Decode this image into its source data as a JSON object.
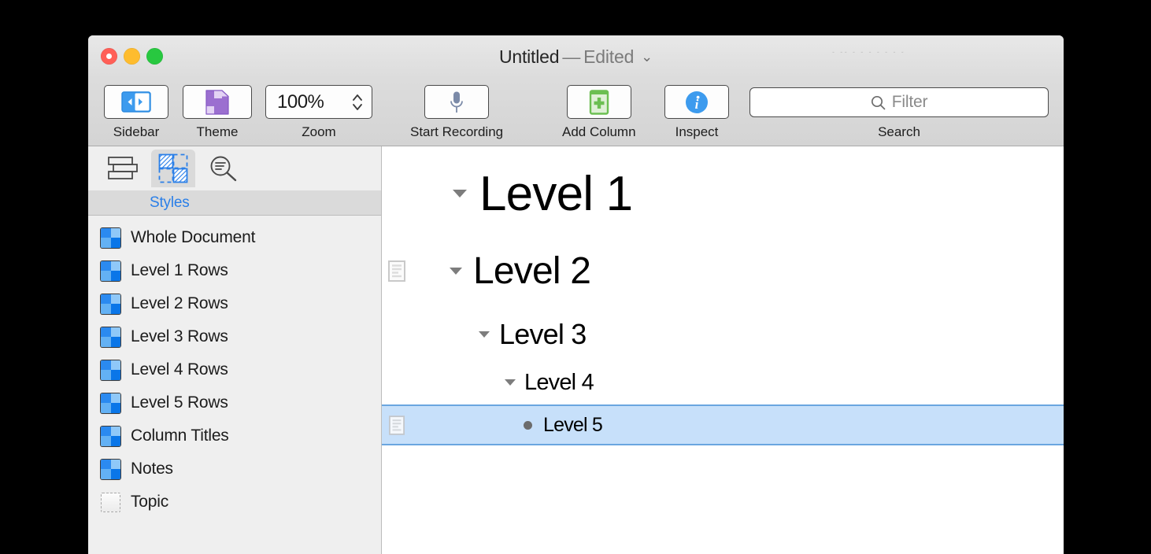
{
  "window": {
    "title_main": "Untitled",
    "title_dash": "—",
    "title_status": "Edited",
    "title_chevron": "⌄",
    "ghost_strip": "- -- - -  -  -   -  -  -"
  },
  "traffic_lights": {
    "close": "close-button",
    "minimize": "minimize-button",
    "maximize": "maximize-button"
  },
  "toolbar": {
    "sidebar": {
      "label": "Sidebar",
      "icon": "sidebar-icon"
    },
    "theme": {
      "label": "Theme",
      "icon": "theme-document-icon"
    },
    "zoom": {
      "label": "Zoom",
      "value": "100%",
      "icon": "stepper-icon"
    },
    "record": {
      "label": "Start Recording",
      "icon": "microphone-icon"
    },
    "add_column": {
      "label": "Add Column",
      "icon": "add-column-icon"
    },
    "inspect": {
      "label": "Inspect",
      "icon": "info-icon"
    },
    "search": {
      "label": "Search",
      "placeholder": "Filter",
      "value": "",
      "icon": "search-icon"
    }
  },
  "sidebar": {
    "tabs": [
      {
        "name": "outline",
        "icon": "outline-structure-icon",
        "selected": false
      },
      {
        "name": "styles",
        "icon": "styles-checkerboard-icon",
        "selected": true
      },
      {
        "name": "search",
        "icon": "filter-search-icon",
        "selected": false
      }
    ],
    "active_tab_title": "Styles",
    "styles": [
      {
        "label": "Whole Document",
        "swatch": "checkerboard"
      },
      {
        "label": "Level 1 Rows",
        "swatch": "checkerboard"
      },
      {
        "label": "Level 2 Rows",
        "swatch": "checkerboard"
      },
      {
        "label": "Level 3 Rows",
        "swatch": "checkerboard"
      },
      {
        "label": "Level 4 Rows",
        "swatch": "checkerboard"
      },
      {
        "label": "Level 5 Rows",
        "swatch": "checkerboard"
      },
      {
        "label": "Column Titles",
        "swatch": "checkerboard"
      },
      {
        "label": "Notes",
        "swatch": "checkerboard"
      },
      {
        "label": "Topic",
        "swatch": "empty-dashed"
      }
    ]
  },
  "outline": {
    "rows": [
      {
        "text": "Level 1",
        "level": 1,
        "marker": "disclosure-triangle",
        "expanded": true,
        "has_note": false,
        "selected": false
      },
      {
        "text": "Level 2",
        "level": 2,
        "marker": "disclosure-triangle",
        "expanded": true,
        "has_note": true,
        "selected": false
      },
      {
        "text": "Level 3",
        "level": 3,
        "marker": "disclosure-triangle",
        "expanded": true,
        "has_note": false,
        "selected": false
      },
      {
        "text": "Level 4",
        "level": 4,
        "marker": "disclosure-triangle",
        "expanded": true,
        "has_note": false,
        "selected": false
      },
      {
        "text": "Level 5",
        "level": 5,
        "marker": "bullet",
        "expanded": false,
        "has_note": true,
        "selected": true
      }
    ]
  },
  "colors": {
    "accent_blue": "#2a7fe8",
    "selection_fill": "#c7e0fa",
    "selection_border": "#6aa6e0",
    "toolbar_bg": "#d8d8d8",
    "sidebar_bg": "#efefef",
    "tab_selected_bg": "#dadada",
    "theme_purple": "#9b6fd0",
    "addcol_green": "#6cbf52",
    "mic_slate": "#7b8aa8"
  }
}
